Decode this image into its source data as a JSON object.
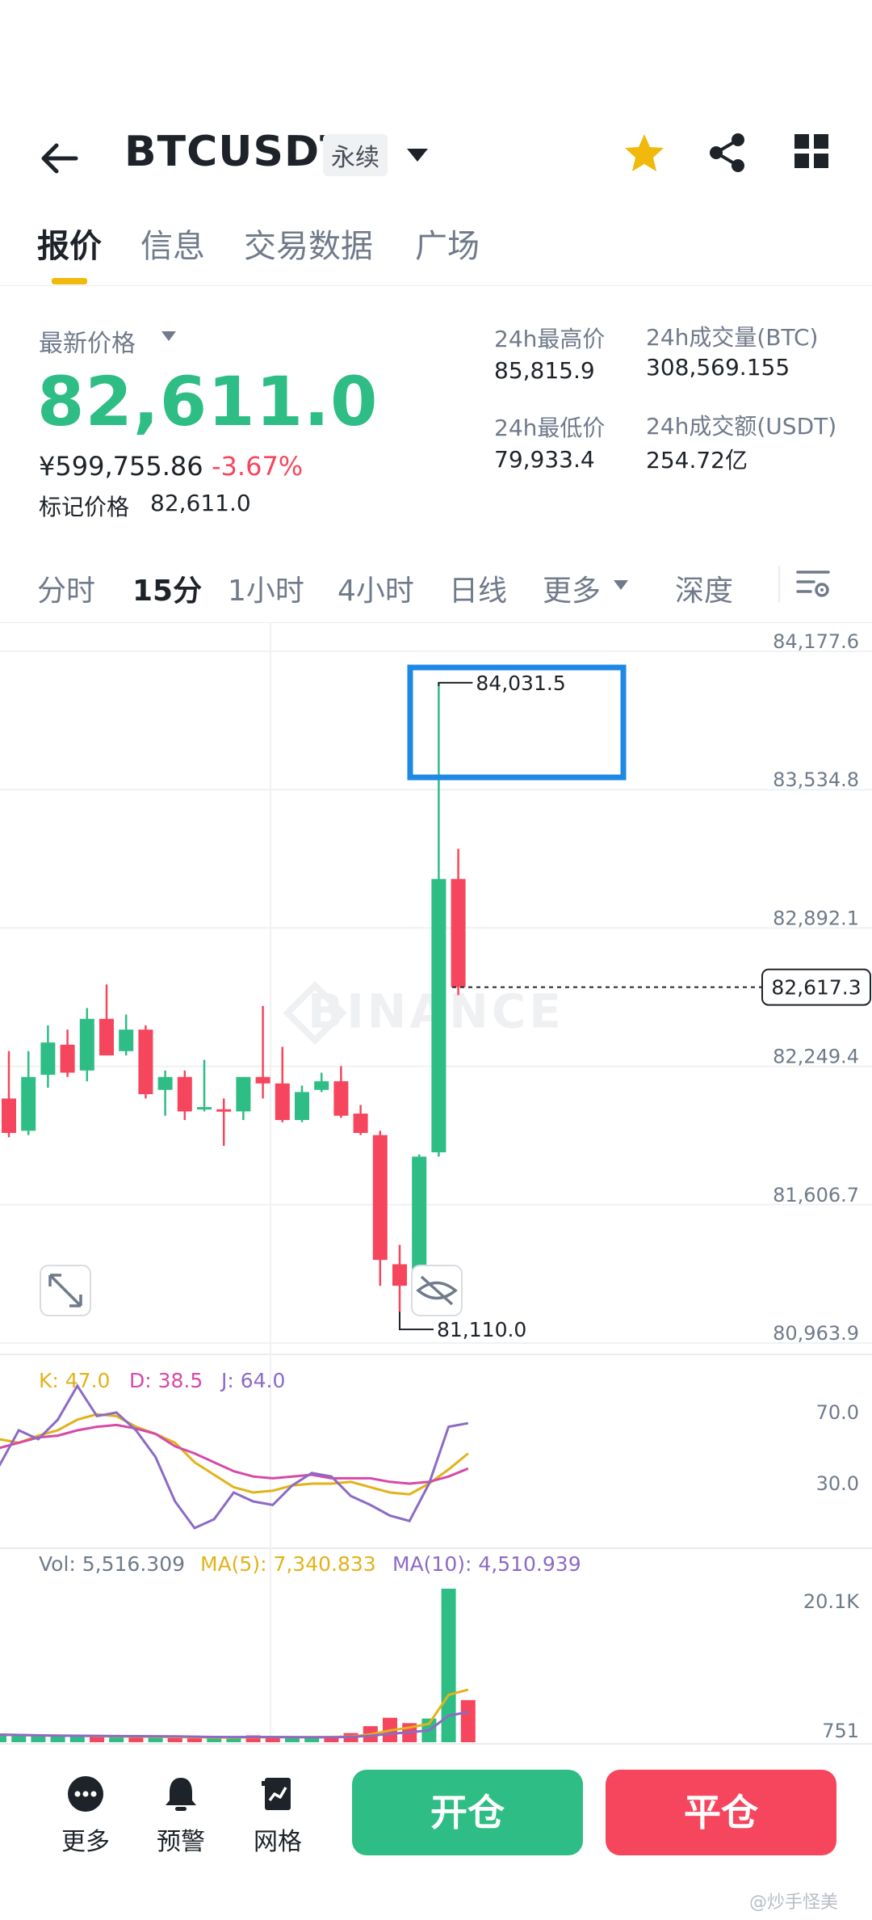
{
  "header": {
    "symbol": "BTCUSDT",
    "contract_type": "永续"
  },
  "tabs": [
    {
      "label": "报价",
      "active": true
    },
    {
      "label": "信息",
      "active": false
    },
    {
      "label": "交易数据",
      "active": false
    },
    {
      "label": "广场",
      "active": false
    }
  ],
  "price": {
    "latest_label": "最新价格",
    "last_price": "82,611.0",
    "cny_price": "¥599,755.86",
    "change_pct": "-3.67%",
    "mark_label": "标记价格",
    "mark_price": "82,611.0"
  },
  "stats": {
    "high_label": "24h最高价",
    "high_value": "85,815.9",
    "low_label": "24h最低价",
    "low_value": "79,933.4",
    "vol_btc_label": "24h成交量(BTC)",
    "vol_btc_value": "308,569.155",
    "vol_usdt_label": "24h成交额(USDT)",
    "vol_usdt_value": "254.72亿"
  },
  "intervals": [
    {
      "label": "分时",
      "active": false
    },
    {
      "label": "15分",
      "active": true
    },
    {
      "label": "1小时",
      "active": false
    },
    {
      "label": "4小时",
      "active": false
    },
    {
      "label": "日线",
      "active": false
    },
    {
      "label": "更多",
      "active": false
    },
    {
      "label": "深度",
      "active": false
    }
  ],
  "chart": {
    "watermark": "BINANCE",
    "price_axis": [
      "84,177.6",
      "83,534.8",
      "82,892.1",
      "82,249.4",
      "81,606.7",
      "80,963.9"
    ],
    "current_price_tag": "82,617.3",
    "max_label": "84,031.5",
    "min_label": "81,110.0",
    "kdj": {
      "k": "K: 47.0",
      "d": "D: 38.5",
      "j": "J: 64.0",
      "axis": [
        "70.0",
        "30.0"
      ]
    },
    "volume": {
      "vol": "Vol: 5,516.309",
      "ma5": "MA(5): 7,340.833",
      "ma10": "MA(10): 4,510.939",
      "axis": [
        "20.1K",
        "751"
      ]
    }
  },
  "chart_data": {
    "type": "candlestick",
    "interval": "15m",
    "candles": [
      {
        "o": 82100,
        "h": 82320,
        "l": 81920,
        "c": 81940
      },
      {
        "o": 81950,
        "h": 82320,
        "l": 81930,
        "c": 82200
      },
      {
        "o": 82210,
        "h": 82440,
        "l": 82150,
        "c": 82360
      },
      {
        "o": 82350,
        "h": 82420,
        "l": 82200,
        "c": 82220
      },
      {
        "o": 82230,
        "h": 82520,
        "l": 82180,
        "c": 82470
      },
      {
        "o": 82470,
        "h": 82630,
        "l": 82440,
        "c": 82300
      },
      {
        "o": 82320,
        "h": 82490,
        "l": 82300,
        "c": 82420
      },
      {
        "o": 82420,
        "h": 82440,
        "l": 82100,
        "c": 82120
      },
      {
        "o": 82140,
        "h": 82230,
        "l": 82020,
        "c": 82200
      },
      {
        "o": 82200,
        "h": 82230,
        "l": 82000,
        "c": 82040
      },
      {
        "o": 82050,
        "h": 82280,
        "l": 82040,
        "c": 82060
      },
      {
        "o": 82050,
        "h": 82100,
        "l": 81880,
        "c": 82040
      },
      {
        "o": 82040,
        "h": 82200,
        "l": 82000,
        "c": 82200
      },
      {
        "o": 82200,
        "h": 82530,
        "l": 82100,
        "c": 82170
      },
      {
        "o": 82170,
        "h": 82340,
        "l": 81990,
        "c": 82000
      },
      {
        "o": 82000,
        "h": 82160,
        "l": 81990,
        "c": 82130
      },
      {
        "o": 82140,
        "h": 82220,
        "l": 82130,
        "c": 82180
      },
      {
        "o": 82180,
        "h": 82250,
        "l": 82010,
        "c": 82020
      },
      {
        "o": 82030,
        "h": 82070,
        "l": 81930,
        "c": 81940
      },
      {
        "o": 81930,
        "h": 81950,
        "l": 81230,
        "c": 81350
      },
      {
        "o": 81330,
        "h": 81420,
        "l": 81110,
        "c": 81230
      },
      {
        "o": 81230,
        "h": 81840,
        "l": 81220,
        "c": 81830
      },
      {
        "o": 81850,
        "h": 84031.5,
        "l": 81830,
        "c": 83120
      },
      {
        "o": 83120,
        "h": 83260,
        "l": 82580,
        "c": 82617.3
      }
    ],
    "price_axis_ticks": [
      84177.6,
      83534.8,
      82892.1,
      82249.4,
      81606.7,
      80963.9
    ],
    "kdj": {
      "k": [
        55,
        53,
        57,
        60,
        66,
        69,
        68,
        62,
        58,
        53,
        42,
        35,
        28,
        25,
        26,
        29,
        30,
        30,
        31,
        28,
        25,
        24,
        30,
        38,
        47
      ],
      "d": [
        50,
        53,
        56,
        57,
        60,
        62,
        63,
        61,
        58,
        51,
        47,
        42,
        37,
        34,
        33,
        34,
        35,
        33,
        33,
        33,
        31,
        30,
        31,
        34,
        38.5
      ],
      "j": [
        40,
        60,
        55,
        66,
        85,
        68,
        70,
        60,
        45,
        20,
        5,
        10,
        25,
        20,
        18,
        29,
        36,
        34,
        23,
        18,
        12,
        9,
        30,
        62,
        64
      ],
      "axis_ticks": [
        70,
        30
      ]
    },
    "volume": {
      "values": [
        1000,
        900,
        800,
        750,
        760,
        780,
        700,
        680,
        650,
        600,
        620,
        580,
        560,
        900,
        720,
        600,
        580,
        620,
        1200,
        2100,
        3200,
        2500,
        3100,
        20100,
        5516.309
      ],
      "up": [
        true,
        true,
        true,
        true,
        true,
        false,
        true,
        false,
        true,
        false,
        false,
        true,
        true,
        false,
        false,
        true,
        true,
        false,
        false,
        false,
        false,
        false,
        true,
        true,
        false
      ],
      "ma5": 7340.833,
      "ma10": 4510.939,
      "axis_ticks": [
        20100,
        751
      ]
    }
  },
  "bottom": {
    "items": [
      {
        "label": "更多",
        "icon": "more-icon"
      },
      {
        "label": "预警",
        "icon": "bell-icon"
      },
      {
        "label": "网格",
        "icon": "grid-strategy-icon"
      }
    ],
    "open_label": "开仓",
    "close_label": "平仓",
    "watermark": "@炒手怪美"
  },
  "colors": {
    "up": "#2ebd85",
    "down": "#f6465d",
    "accent": "#f0b90b",
    "highlight_box": "#1e88e5",
    "k_line": "#e3b21a",
    "d_line": "#d54aa8",
    "j_line": "#8c6bc4"
  }
}
